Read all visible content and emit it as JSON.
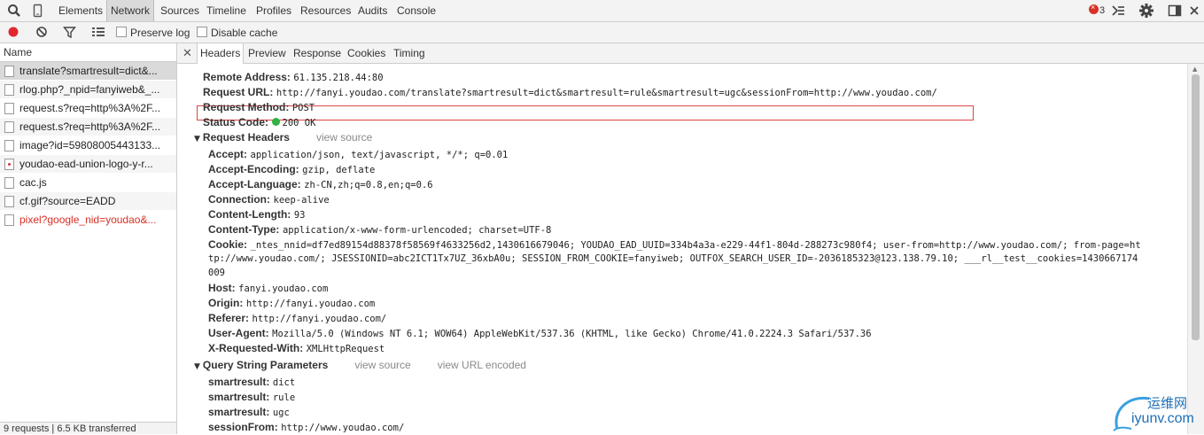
{
  "toolbar": {
    "tabs": [
      "Elements",
      "Network",
      "Sources",
      "Timeline",
      "Profiles",
      "Resources",
      "Audits",
      "Console"
    ],
    "error_count": "3"
  },
  "filterbar": {
    "preserve_log": "Preserve log",
    "disable_cache": "Disable cache"
  },
  "requests": {
    "header": "Name",
    "items": [
      {
        "name": "translate?smartresult=dict&...",
        "type": "doc"
      },
      {
        "name": "rlog.php?_npid=fanyiweb&_...",
        "type": "doc"
      },
      {
        "name": "request.s?req=http%3A%2F...",
        "type": "doc"
      },
      {
        "name": "request.s?req=http%3A%2F...",
        "type": "doc"
      },
      {
        "name": "image?id=59808005443133...",
        "type": "doc"
      },
      {
        "name": "youdao-ead-union-logo-y-r...",
        "type": "img"
      },
      {
        "name": "cac.js",
        "type": "doc"
      },
      {
        "name": "cf.gif?source=EADD",
        "type": "doc"
      },
      {
        "name": "pixel?google_nid=youdao&...",
        "type": "doc"
      }
    ],
    "status": "9 requests | 6.5 KB transferred"
  },
  "detail_tabs": [
    "Headers",
    "Preview",
    "Response",
    "Cookies",
    "Timing"
  ],
  "general": [
    {
      "k": "Remote Address:",
      "v": "61.135.218.44:80"
    },
    {
      "k": "Request URL:",
      "v": "http://fanyi.youdao.com/translate?smartresult=dict&smartresult=rule&smartresult=ugc&sessionFrom=http://www.youdao.com/"
    },
    {
      "k": "Request Method:",
      "v": "POST"
    },
    {
      "k": "Status Code:",
      "v": "200 OK"
    }
  ],
  "request_headers": {
    "title": "Request Headers",
    "view_source": "view source",
    "items": [
      {
        "k": "Accept:",
        "v": "application/json, text/javascript, */*; q=0.01"
      },
      {
        "k": "Accept-Encoding:",
        "v": "gzip, deflate"
      },
      {
        "k": "Accept-Language:",
        "v": "zh-CN,zh;q=0.8,en;q=0.6"
      },
      {
        "k": "Connection:",
        "v": "keep-alive"
      },
      {
        "k": "Content-Length:",
        "v": "93"
      },
      {
        "k": "Content-Type:",
        "v": "application/x-www-form-urlencoded; charset=UTF-8"
      },
      {
        "k": "Cookie:",
        "v": "_ntes_nnid=df7ed89154d88378f58569f4633256d2,1430616679046; YOUDAO_EAD_UUID=334b4a3a-e229-44f1-804d-288273c980f4; user-from=http://www.youdao.com/; from-page=ht",
        "v2": "tp://www.youdao.com/; JSESSIONID=abc2ICT1Tx7UZ_36xbA0u; SESSION_FROM_COOKIE=fanyiweb; OUTFOX_SEARCH_USER_ID=-2036185323@123.138.79.10; ___rl__test__cookies=1430667174",
        "v3": "009"
      },
      {
        "k": "Host:",
        "v": "fanyi.youdao.com"
      },
      {
        "k": "Origin:",
        "v": "http://fanyi.youdao.com"
      },
      {
        "k": "Referer:",
        "v": "http://fanyi.youdao.com/"
      },
      {
        "k": "User-Agent:",
        "v": "Mozilla/5.0 (Windows NT 6.1; WOW64) AppleWebKit/537.36 (KHTML, like Gecko) Chrome/41.0.2224.3 Safari/537.36"
      },
      {
        "k": "X-Requested-With:",
        "v": "XMLHttpRequest"
      }
    ]
  },
  "query_params": {
    "title": "Query String Parameters",
    "view_source": "view source",
    "view_url_encoded": "view URL encoded",
    "items": [
      {
        "k": "smartresult:",
        "v": "dict"
      },
      {
        "k": "smartresult:",
        "v": "rule"
      },
      {
        "k": "smartresult:",
        "v": "ugc"
      },
      {
        "k": "sessionFrom:",
        "v": "http://www.youdao.com/"
      }
    ]
  },
  "watermark": {
    "cn": "运维网",
    "url": "iyunv.com"
  }
}
